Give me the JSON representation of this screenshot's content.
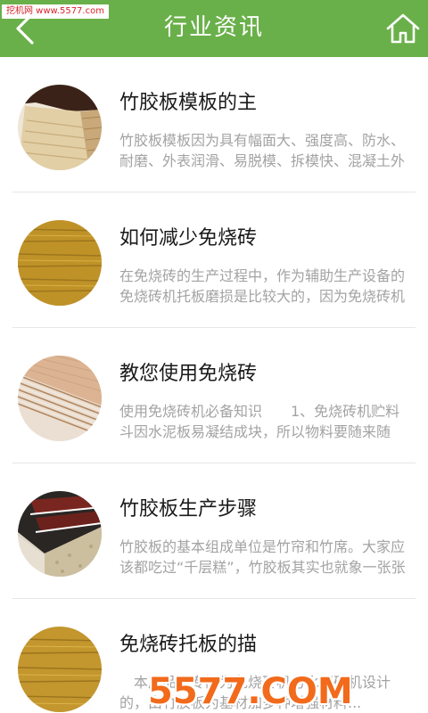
{
  "header": {
    "title": "行业资讯",
    "background_color": "#6ab04a",
    "watermark_text": "挖机网 www.5577.com",
    "back_icon": "chevron-left-icon",
    "home_icon": "home-icon"
  },
  "articles": [
    {
      "title": "竹胶板模板的主",
      "description": "竹胶板模板因为具有幅面大、强度高、防水、耐磨、外表润滑、易脱模、拆模快、混凝土外表...",
      "image": "plywood-stack-photo"
    },
    {
      "title": "如何减少免烧砖",
      "description": "在免烧砖的生产过程中，作为辅助生产设备的免烧砖机托板磨损是比较大的，因为免烧砖机的托板...",
      "image": "yellow-bamboo-board-photo"
    },
    {
      "title": "教您使用免烧砖",
      "description": "使用免烧砖机必备知识　　1、免烧砖机贮料斗因水泥板易凝结成块，所以物料要随来随用...",
      "image": "plywood-sheets-photo"
    },
    {
      "title": "竹胶板生产步骤",
      "description": "竹胶板的基本组成单位是竹帘和竹席。大家应该都吃过“千层糕”，竹胶板其实也就象一张张竹帘...",
      "image": "film-faced-boards-photo"
    },
    {
      "title": "免烧砖托板的描",
      "description": "　本产品是专门为免烧砖机与水泥砖机设计的，由竹胶板为基材加多种增强材料...",
      "image": "bamboo-pallet-photo"
    }
  ],
  "watermark_bottom": "5577.COM"
}
